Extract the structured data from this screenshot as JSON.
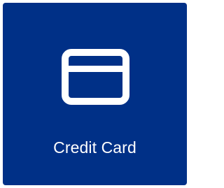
{
  "tile": {
    "label": "Credit Card",
    "icon": "credit-card-icon",
    "background_color": "#003087",
    "foreground_color": "#ffffff"
  }
}
